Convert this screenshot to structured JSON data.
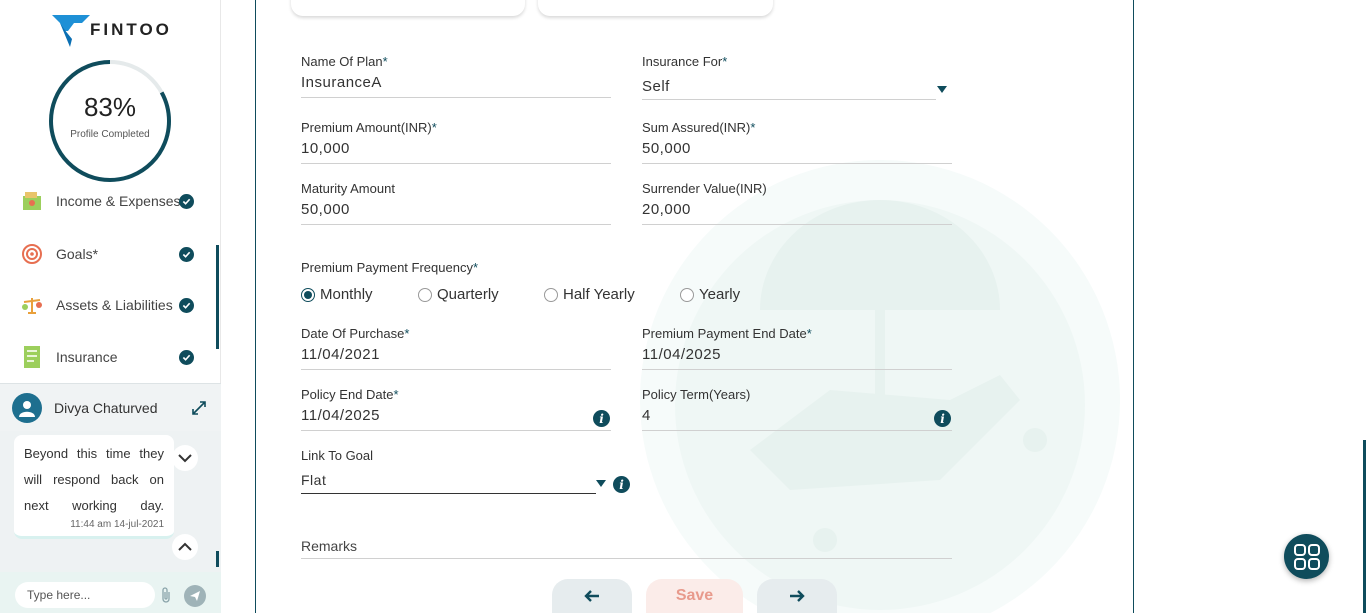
{
  "brand": {
    "name": "FINTOO",
    "accent": "#0f4c5c",
    "logo_blue": "#1e90d6"
  },
  "profile": {
    "percent": "83%",
    "percent_value": 83,
    "label": "Profile Completed"
  },
  "nav": [
    {
      "label": "Income & Expenses",
      "icon": "wallet-icon",
      "done": true
    },
    {
      "label": "Goals*",
      "icon": "target-icon",
      "done": true
    },
    {
      "label": "Assets & Liabilities",
      "icon": "scale-icon",
      "done": true
    },
    {
      "label": "Insurance",
      "icon": "document-icon",
      "done": true
    }
  ],
  "chat": {
    "name": "Divya Chaturved",
    "message": "Beyond this time they will respond back on next working day.",
    "time": "11:44 am 14-jul-2021",
    "placeholder": "Type here..."
  },
  "form": {
    "name_of_plan": {
      "label": "Name Of Plan",
      "required": "*",
      "value": "InsuranceA"
    },
    "insurance_for": {
      "label": "Insurance For",
      "required": "*",
      "value": "Self"
    },
    "premium_amount": {
      "label": "Premium Amount(INR)",
      "required": "*",
      "value": "10,000"
    },
    "sum_assured": {
      "label": "Sum Assured(INR)",
      "required": "*",
      "value": "50,000"
    },
    "maturity_amount": {
      "label": "Maturity Amount",
      "value": "50,000"
    },
    "surrender_value": {
      "label": "Surrender Value(INR)",
      "value": "20,000"
    },
    "frequency": {
      "label": "Premium Payment Frequency",
      "required": "*",
      "options": [
        "Monthly",
        "Quarterly",
        "Half Yearly",
        "Yearly"
      ],
      "selected": "Monthly"
    },
    "date_of_purchase": {
      "label": "Date Of Purchase",
      "required": "*",
      "value": "11/04/2021"
    },
    "premium_end_date": {
      "label": "Premium Payment End Date",
      "required": "*",
      "value": "11/04/2025"
    },
    "policy_end_date": {
      "label": "Policy End Date",
      "required": "*",
      "value": "11/04/2025"
    },
    "policy_term": {
      "label": "Policy Term(Years)",
      "value": "4"
    },
    "link_to_goal": {
      "label": "Link To Goal",
      "value": "Flat"
    },
    "remarks": {
      "placeholder": "Remarks"
    }
  },
  "actions": {
    "save": "Save"
  }
}
